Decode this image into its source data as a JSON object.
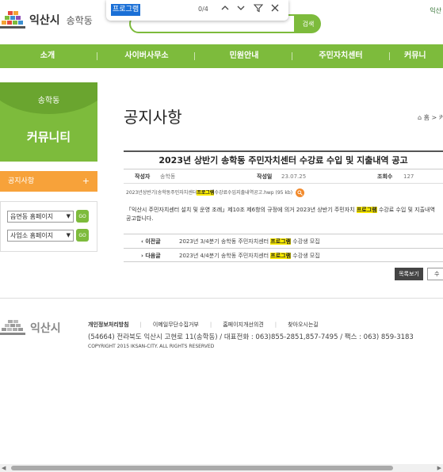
{
  "header": {
    "city": "익산시",
    "dong": "송학동",
    "search_button": "검색",
    "top_right": "익산"
  },
  "findbar": {
    "query": "프로그램",
    "count": "0/4"
  },
  "nav": {
    "items": [
      "소개",
      "사이버사무소",
      "민원안내",
      "주민자치센터",
      "커뮤니"
    ]
  },
  "sidebar": {
    "dong": "송학동",
    "title": "커뮤니티",
    "menu_item": "공지사항",
    "menu_plus": "+",
    "links": [
      {
        "label": "읍면동 홈페이지",
        "go": "GO"
      },
      {
        "label": "사업소 홈페이지",
        "go": "GO"
      }
    ]
  },
  "content": {
    "page_title": "공지사항",
    "breadcrumb": "홈 > 커",
    "post_title": "2023년 상반기 송학동 주민자치센터 수강료 수입 및 지출내역 공고",
    "meta": {
      "author_label": "작성자",
      "author": "송학동",
      "date_label": "작성일",
      "date": "23.07.25",
      "views_label": "조회수",
      "views": "127"
    },
    "attachment": {
      "prefix": "2023년상반기(송학동주민자치센터",
      "highlight": "프로그램",
      "suffix": "수강료수입지출내역공고.hwp (95 kb)"
    },
    "body": {
      "line1_prefix": "「익산시 주민자치센터 설치 및 운영 조례」제10조  제6항의 규정에 의거 2023년 상반기 주민자치 ",
      "line1_highlight": "프로그램",
      "line1_suffix": " 수강료 수입 및 지출내역",
      "line2": "공고합니다."
    },
    "prev": {
      "label": "이전글",
      "text_prefix": "2023년 3/4분기 송학동 주민자치센터 ",
      "highlight": "프로그램",
      "text_suffix": " 수강생 모집"
    },
    "next": {
      "label": "다음글",
      "text_prefix": "2023년 4/4분기 송학동 주민자치센터 ",
      "highlight": "프로그램",
      "text_suffix": " 수강생 모집"
    },
    "list_button": "목록보기",
    "edit_button": "수"
  },
  "footer": {
    "logo_text": "익산시",
    "links": [
      "개인정보처리방침",
      "이메일무단수집거부",
      "홈페이지개선의견",
      "찾아오시는길"
    ],
    "address": "(54664) 전라북도 익산시 고현로 11(송학동) / 대표전화 : 063)855-2851,857-7495 / 팩스 : 063) 859-3183",
    "copyright": "COPYRIGHT 2015 IKSAN-CITY. ALL RIGHTS RESERVED"
  },
  "colors": {
    "brand_green": "#7dbb3c",
    "accent_orange": "#f7a23a",
    "highlight": "#ffee00"
  }
}
